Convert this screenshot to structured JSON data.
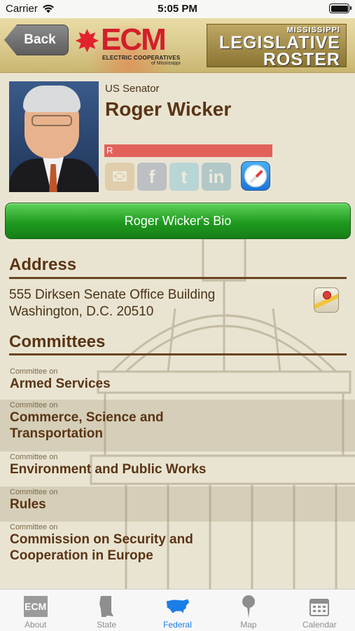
{
  "status_bar": {
    "carrier": "Carrier",
    "time": "5:05 PM"
  },
  "header": {
    "back_label": "Back",
    "logo_text": "ECM",
    "logo_subtitle": "ELECTRIC COOPERATIVES",
    "logo_subtitle2": "of Mississippi",
    "title_small": "MISSISSIPPI",
    "title_line1": "LEGISLATIVE",
    "title_line2": "ROSTER"
  },
  "profile": {
    "role": "US Senator",
    "name": "Roger Wicker",
    "party": "R",
    "party_color": "#e2625b"
  },
  "social": {
    "mail": "mail-icon",
    "facebook": "f",
    "twitter": "t",
    "linkedin": "in",
    "web": "safari-icon"
  },
  "bio_button": {
    "label": "Roger Wicker's Bio"
  },
  "address": {
    "title": "Address",
    "line1": "555 Dirksen Senate Office Building",
    "line2": "Washington, D.C. 20510"
  },
  "committees": {
    "title": "Committees",
    "caption": "Committee on",
    "items": [
      {
        "name": "Armed Services"
      },
      {
        "name": "Commerce, Science and Transportation"
      },
      {
        "name": "Environment and Public Works"
      },
      {
        "name": "Rules"
      },
      {
        "name": "Commission on Security and Cooperation in Europe"
      }
    ]
  },
  "tab_bar": {
    "items": [
      {
        "label": "About",
        "icon": "ecm-icon",
        "active": false
      },
      {
        "label": "State",
        "icon": "mississippi-icon",
        "active": false
      },
      {
        "label": "Federal",
        "icon": "usa-map-icon",
        "active": true
      },
      {
        "label": "Map",
        "icon": "map-pin-icon",
        "active": false
      },
      {
        "label": "Calendar",
        "icon": "calendar-icon",
        "active": false
      }
    ],
    "active_color": "#1a7de8"
  }
}
